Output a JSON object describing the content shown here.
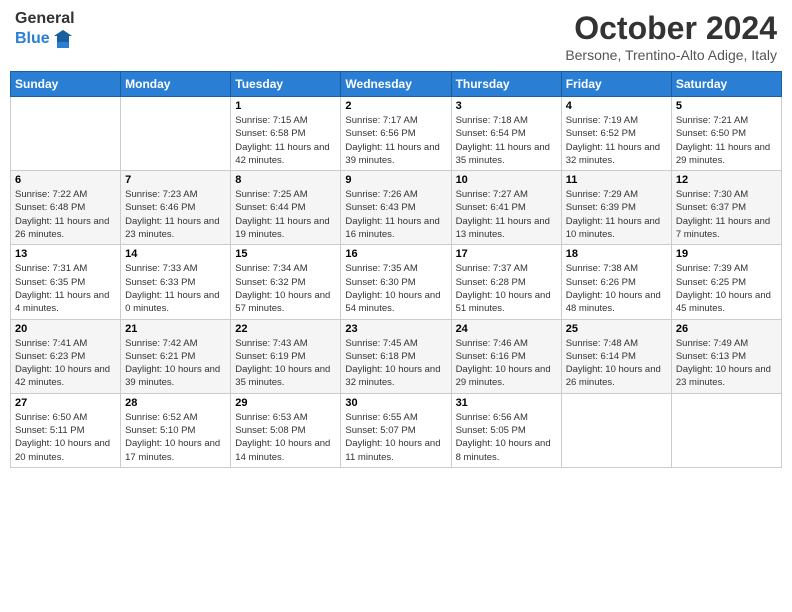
{
  "header": {
    "logo_line1": "General",
    "logo_line2": "Blue",
    "month_title": "October 2024",
    "subtitle": "Bersone, Trentino-Alto Adige, Italy"
  },
  "days_of_week": [
    "Sunday",
    "Monday",
    "Tuesday",
    "Wednesday",
    "Thursday",
    "Friday",
    "Saturday"
  ],
  "weeks": [
    [
      {
        "day": "",
        "sunrise": "",
        "sunset": "",
        "daylight": ""
      },
      {
        "day": "",
        "sunrise": "",
        "sunset": "",
        "daylight": ""
      },
      {
        "day": "1",
        "sunrise": "Sunrise: 7:15 AM",
        "sunset": "Sunset: 6:58 PM",
        "daylight": "Daylight: 11 hours and 42 minutes."
      },
      {
        "day": "2",
        "sunrise": "Sunrise: 7:17 AM",
        "sunset": "Sunset: 6:56 PM",
        "daylight": "Daylight: 11 hours and 39 minutes."
      },
      {
        "day": "3",
        "sunrise": "Sunrise: 7:18 AM",
        "sunset": "Sunset: 6:54 PM",
        "daylight": "Daylight: 11 hours and 35 minutes."
      },
      {
        "day": "4",
        "sunrise": "Sunrise: 7:19 AM",
        "sunset": "Sunset: 6:52 PM",
        "daylight": "Daylight: 11 hours and 32 minutes."
      },
      {
        "day": "5",
        "sunrise": "Sunrise: 7:21 AM",
        "sunset": "Sunset: 6:50 PM",
        "daylight": "Daylight: 11 hours and 29 minutes."
      }
    ],
    [
      {
        "day": "6",
        "sunrise": "Sunrise: 7:22 AM",
        "sunset": "Sunset: 6:48 PM",
        "daylight": "Daylight: 11 hours and 26 minutes."
      },
      {
        "day": "7",
        "sunrise": "Sunrise: 7:23 AM",
        "sunset": "Sunset: 6:46 PM",
        "daylight": "Daylight: 11 hours and 23 minutes."
      },
      {
        "day": "8",
        "sunrise": "Sunrise: 7:25 AM",
        "sunset": "Sunset: 6:44 PM",
        "daylight": "Daylight: 11 hours and 19 minutes."
      },
      {
        "day": "9",
        "sunrise": "Sunrise: 7:26 AM",
        "sunset": "Sunset: 6:43 PM",
        "daylight": "Daylight: 11 hours and 16 minutes."
      },
      {
        "day": "10",
        "sunrise": "Sunrise: 7:27 AM",
        "sunset": "Sunset: 6:41 PM",
        "daylight": "Daylight: 11 hours and 13 minutes."
      },
      {
        "day": "11",
        "sunrise": "Sunrise: 7:29 AM",
        "sunset": "Sunset: 6:39 PM",
        "daylight": "Daylight: 11 hours and 10 minutes."
      },
      {
        "day": "12",
        "sunrise": "Sunrise: 7:30 AM",
        "sunset": "Sunset: 6:37 PM",
        "daylight": "Daylight: 11 hours and 7 minutes."
      }
    ],
    [
      {
        "day": "13",
        "sunrise": "Sunrise: 7:31 AM",
        "sunset": "Sunset: 6:35 PM",
        "daylight": "Daylight: 11 hours and 4 minutes."
      },
      {
        "day": "14",
        "sunrise": "Sunrise: 7:33 AM",
        "sunset": "Sunset: 6:33 PM",
        "daylight": "Daylight: 11 hours and 0 minutes."
      },
      {
        "day": "15",
        "sunrise": "Sunrise: 7:34 AM",
        "sunset": "Sunset: 6:32 PM",
        "daylight": "Daylight: 10 hours and 57 minutes."
      },
      {
        "day": "16",
        "sunrise": "Sunrise: 7:35 AM",
        "sunset": "Sunset: 6:30 PM",
        "daylight": "Daylight: 10 hours and 54 minutes."
      },
      {
        "day": "17",
        "sunrise": "Sunrise: 7:37 AM",
        "sunset": "Sunset: 6:28 PM",
        "daylight": "Daylight: 10 hours and 51 minutes."
      },
      {
        "day": "18",
        "sunrise": "Sunrise: 7:38 AM",
        "sunset": "Sunset: 6:26 PM",
        "daylight": "Daylight: 10 hours and 48 minutes."
      },
      {
        "day": "19",
        "sunrise": "Sunrise: 7:39 AM",
        "sunset": "Sunset: 6:25 PM",
        "daylight": "Daylight: 10 hours and 45 minutes."
      }
    ],
    [
      {
        "day": "20",
        "sunrise": "Sunrise: 7:41 AM",
        "sunset": "Sunset: 6:23 PM",
        "daylight": "Daylight: 10 hours and 42 minutes."
      },
      {
        "day": "21",
        "sunrise": "Sunrise: 7:42 AM",
        "sunset": "Sunset: 6:21 PM",
        "daylight": "Daylight: 10 hours and 39 minutes."
      },
      {
        "day": "22",
        "sunrise": "Sunrise: 7:43 AM",
        "sunset": "Sunset: 6:19 PM",
        "daylight": "Daylight: 10 hours and 35 minutes."
      },
      {
        "day": "23",
        "sunrise": "Sunrise: 7:45 AM",
        "sunset": "Sunset: 6:18 PM",
        "daylight": "Daylight: 10 hours and 32 minutes."
      },
      {
        "day": "24",
        "sunrise": "Sunrise: 7:46 AM",
        "sunset": "Sunset: 6:16 PM",
        "daylight": "Daylight: 10 hours and 29 minutes."
      },
      {
        "day": "25",
        "sunrise": "Sunrise: 7:48 AM",
        "sunset": "Sunset: 6:14 PM",
        "daylight": "Daylight: 10 hours and 26 minutes."
      },
      {
        "day": "26",
        "sunrise": "Sunrise: 7:49 AM",
        "sunset": "Sunset: 6:13 PM",
        "daylight": "Daylight: 10 hours and 23 minutes."
      }
    ],
    [
      {
        "day": "27",
        "sunrise": "Sunrise: 6:50 AM",
        "sunset": "Sunset: 5:11 PM",
        "daylight": "Daylight: 10 hours and 20 minutes."
      },
      {
        "day": "28",
        "sunrise": "Sunrise: 6:52 AM",
        "sunset": "Sunset: 5:10 PM",
        "daylight": "Daylight: 10 hours and 17 minutes."
      },
      {
        "day": "29",
        "sunrise": "Sunrise: 6:53 AM",
        "sunset": "Sunset: 5:08 PM",
        "daylight": "Daylight: 10 hours and 14 minutes."
      },
      {
        "day": "30",
        "sunrise": "Sunrise: 6:55 AM",
        "sunset": "Sunset: 5:07 PM",
        "daylight": "Daylight: 10 hours and 11 minutes."
      },
      {
        "day": "31",
        "sunrise": "Sunrise: 6:56 AM",
        "sunset": "Sunset: 5:05 PM",
        "daylight": "Daylight: 10 hours and 8 minutes."
      },
      {
        "day": "",
        "sunrise": "",
        "sunset": "",
        "daylight": ""
      },
      {
        "day": "",
        "sunrise": "",
        "sunset": "",
        "daylight": ""
      }
    ]
  ]
}
